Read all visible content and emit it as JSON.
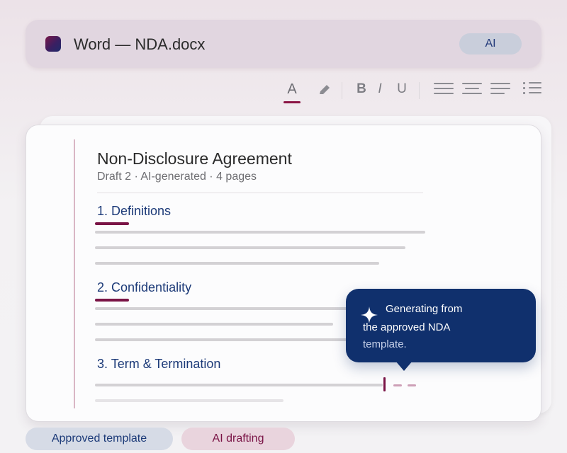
{
  "window": {
    "title": "Word — NDA.docx",
    "ai_button": "AI"
  },
  "toolbar": {
    "font_color": "A",
    "bold": "B",
    "italic": "I",
    "underline": "U"
  },
  "document": {
    "title": "Non-Disclosure Agreement",
    "subtitle": "Draft 2 · AI-generated · 4 pages",
    "sections": [
      {
        "heading": "1. Definitions"
      },
      {
        "heading": "2. Confidentiality"
      },
      {
        "heading": "3. Term & Termination"
      }
    ]
  },
  "tooltip": {
    "line1": "Generating from",
    "line2": "the approved NDA",
    "line3": "template.",
    "icon": "sparkle-icon"
  },
  "chips": {
    "approved_template": "Approved template",
    "ai_drafting": "AI drafting"
  },
  "colors": {
    "accent": "#7a1446",
    "navy": "#10306d",
    "heading": "#1c3a78"
  }
}
